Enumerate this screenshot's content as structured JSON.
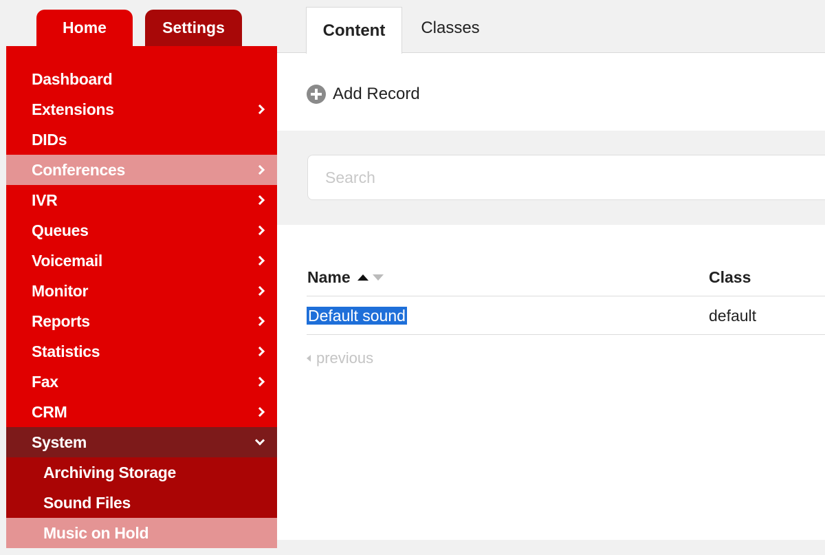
{
  "top_tabs": {
    "home": "Home",
    "settings": "Settings"
  },
  "menu": [
    {
      "label": "Dashboard",
      "arrow": false
    },
    {
      "label": "Extensions",
      "arrow": true
    },
    {
      "label": "DIDs",
      "arrow": false
    },
    {
      "label": "Conferences",
      "arrow": true
    },
    {
      "label": "IVR",
      "arrow": true
    },
    {
      "label": "Queues",
      "arrow": true
    },
    {
      "label": "Voicemail",
      "arrow": true
    },
    {
      "label": "Monitor",
      "arrow": true
    },
    {
      "label": "Reports",
      "arrow": true
    },
    {
      "label": "Statistics",
      "arrow": true
    },
    {
      "label": "Fax",
      "arrow": true
    },
    {
      "label": "CRM",
      "arrow": true
    },
    {
      "label": "System",
      "arrow": "down"
    }
  ],
  "submenu": [
    {
      "label": "Archiving Storage"
    },
    {
      "label": "Sound Files"
    },
    {
      "label": "Music on Hold"
    }
  ],
  "tabs": {
    "content": "Content",
    "classes": "Classes"
  },
  "toolbar": {
    "add_record": "Add Record"
  },
  "search": {
    "placeholder": "Search",
    "value": ""
  },
  "table": {
    "headers": {
      "name": "Name",
      "class": "Class"
    },
    "rows": [
      {
        "name": "Default sound",
        "class": "default"
      }
    ]
  },
  "pager": {
    "previous": "previous"
  },
  "colors": {
    "brand_red": "#e00000",
    "highlight": "#e49494",
    "open_section": "#7d1a1a",
    "selection": "#1e6fd9"
  }
}
